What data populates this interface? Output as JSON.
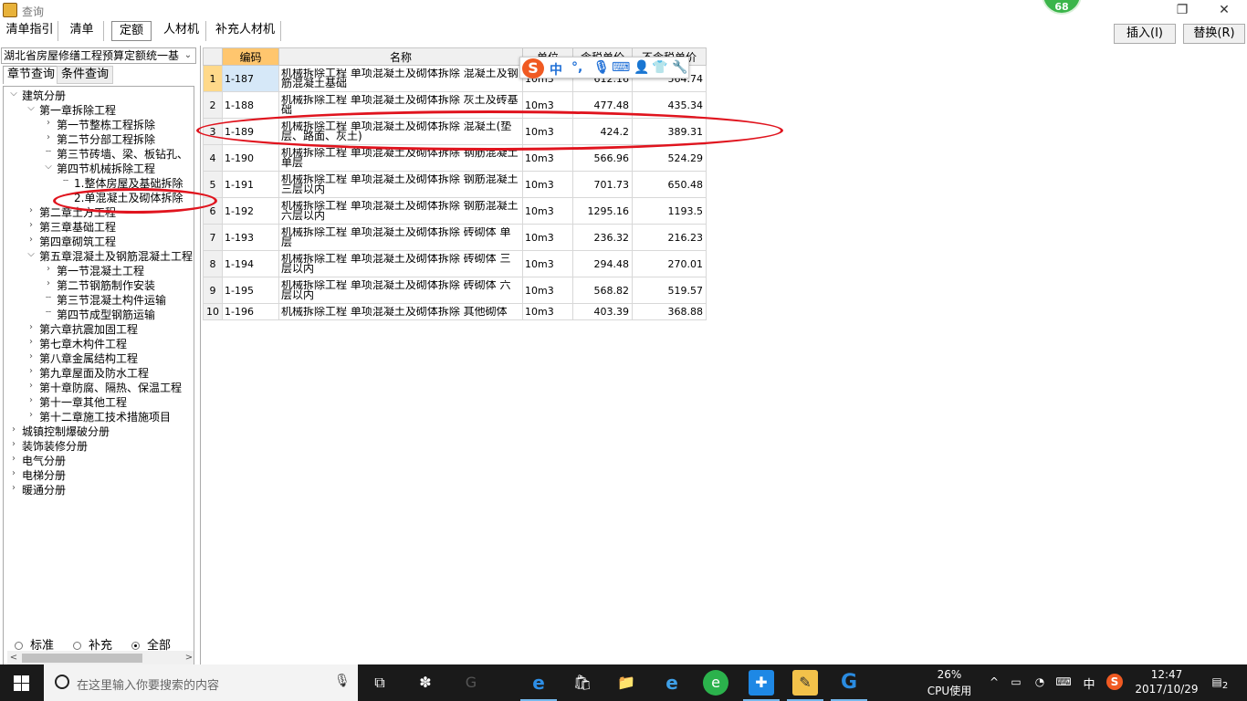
{
  "window": {
    "title": "查询"
  },
  "badge": {
    "value": "68"
  },
  "top_tabs": [
    "清单指引",
    "清单",
    "定额",
    "人材机",
    "补充人材机"
  ],
  "actions": {
    "insert": "插入(I)",
    "replace": "替换(R)"
  },
  "left": {
    "combo_value": "湖北省房屋修缮工程预算定额统一基",
    "sub_tabs": [
      "章节查询",
      "条件查询"
    ],
    "tree": [
      {
        "label": "建筑分册",
        "state": "open"
      },
      {
        "label": "第一章拆除工程",
        "state": "open"
      },
      {
        "label": "第一节整栋工程拆除",
        "state": "closed"
      },
      {
        "label": "第二节分部工程拆除",
        "state": "closed"
      },
      {
        "label": "第三节砖墙、梁、板钻孔、",
        "state": "leaf"
      },
      {
        "label": "第四节机械拆除工程",
        "state": "open"
      },
      {
        "label": "1.整体房屋及基础拆除",
        "state": "leaf"
      },
      {
        "label": "2.单混凝土及砌体拆除",
        "state": "leaf"
      },
      {
        "label": "第二章土方工程",
        "state": "closed"
      },
      {
        "label": "第三章基础工程",
        "state": "closed"
      },
      {
        "label": "第四章砌筑工程",
        "state": "closed"
      },
      {
        "label": "第五章混凝土及钢筋混凝土工程",
        "state": "open"
      },
      {
        "label": "第一节混凝土工程",
        "state": "closed"
      },
      {
        "label": "第二节钢筋制作安装",
        "state": "closed"
      },
      {
        "label": "第三节混凝土构件运输",
        "state": "leaf"
      },
      {
        "label": "第四节成型钢筋运输",
        "state": "leaf"
      },
      {
        "label": "第六章抗震加固工程",
        "state": "closed"
      },
      {
        "label": "第七章木构件工程",
        "state": "closed"
      },
      {
        "label": "第八章金属结构工程",
        "state": "closed"
      },
      {
        "label": "第九章屋面及防水工程",
        "state": "closed"
      },
      {
        "label": "第十章防腐、隔热、保温工程",
        "state": "closed"
      },
      {
        "label": "第十一章其他工程",
        "state": "closed"
      },
      {
        "label": "第十二章施工技术措施项目",
        "state": "closed"
      },
      {
        "label": "城镇控制爆破分册",
        "state": "closed"
      },
      {
        "label": "装饰装修分册",
        "state": "closed"
      },
      {
        "label": "电气分册",
        "state": "closed"
      },
      {
        "label": "电梯分册",
        "state": "closed"
      },
      {
        "label": "暖通分册",
        "state": "closed"
      }
    ],
    "radios": [
      {
        "label": "标准",
        "checked": false
      },
      {
        "label": "补充",
        "checked": false
      },
      {
        "label": "全部",
        "checked": true
      }
    ]
  },
  "grid": {
    "headers": [
      "",
      "编码",
      "名称",
      "单位",
      "含税单价",
      "不含税单价"
    ],
    "rows": [
      [
        "1",
        "1-187",
        "机械拆除工程 单项混凝土及砌体拆除 混凝土及钢筋混凝土基础",
        "10m3",
        "612.16",
        "564.74"
      ],
      [
        "2",
        "1-188",
        "机械拆除工程 单项混凝土及砌体拆除 灰土及砖基础",
        "10m3",
        "477.48",
        "435.34"
      ],
      [
        "3",
        "1-189",
        "机械拆除工程 单项混凝土及砌体拆除 混凝土(垫层、路面、灰土)",
        "10m3",
        "424.2",
        "389.31"
      ],
      [
        "4",
        "1-190",
        "机械拆除工程 单项混凝土及砌体拆除 钢筋混凝土 单层",
        "10m3",
        "566.96",
        "524.29"
      ],
      [
        "5",
        "1-191",
        "机械拆除工程 单项混凝土及砌体拆除 钢筋混凝土 三层以内",
        "10m3",
        "701.73",
        "650.48"
      ],
      [
        "6",
        "1-192",
        "机械拆除工程 单项混凝土及砌体拆除 钢筋混凝土 六层以内",
        "10m3",
        "1295.16",
        "1193.5"
      ],
      [
        "7",
        "1-193",
        "机械拆除工程 单项混凝土及砌体拆除 砖砌体 单层",
        "10m3",
        "236.32",
        "216.23"
      ],
      [
        "8",
        "1-194",
        "机械拆除工程 单项混凝土及砌体拆除 砖砌体 三层以内",
        "10m3",
        "294.48",
        "270.01"
      ],
      [
        "9",
        "1-195",
        "机械拆除工程 单项混凝土及砌体拆除 砖砌体 六层以内",
        "10m3",
        "568.82",
        "519.57"
      ],
      [
        "10",
        "1-196",
        "机械拆除工程 单项混凝土及砌体拆除 其他砌体",
        "10m3",
        "403.39",
        "368.88"
      ]
    ]
  },
  "ime": {
    "logo": "S",
    "mode": "中",
    "punct": "°,"
  },
  "taskbar": {
    "search_placeholder": "在这里输入你要搜索的内容",
    "cpu_percent": "26%",
    "cpu_label": "CPU使用",
    "ime_lang": "中",
    "time": "12:47",
    "date": "2017/10/29",
    "notifications": "2"
  },
  "colors": {
    "accent_header": "#ffc66e",
    "annotation": "#e0141e",
    "taskbar": "#1a1a1a"
  }
}
